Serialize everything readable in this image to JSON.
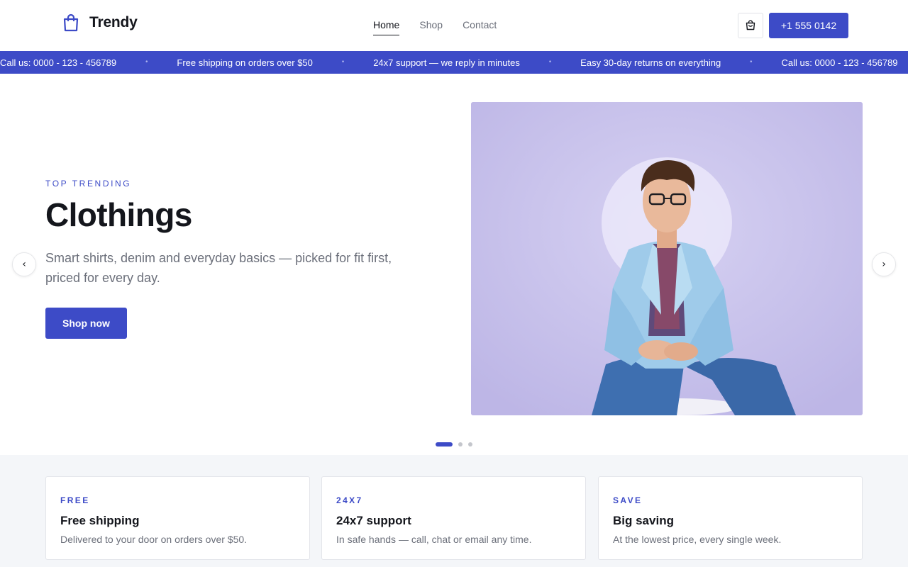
{
  "brand": {
    "name": "Trendy",
    "icon": "shopping-bag-icon",
    "accent": "#3d4bc7"
  },
  "nav": {
    "items": [
      "Home",
      "Shop",
      "Contact"
    ],
    "active": "Home"
  },
  "header": {
    "cart_icon": "cart-icon",
    "phone_label": "+1 555 0142"
  },
  "ticker": {
    "items": [
      "Call us: 0000 - 123 - 456789",
      "Free shipping on orders over $50",
      "24x7 support — we reply in minutes",
      "Easy 30-day returns on everything",
      "Call us: 0000 - 123 - 456789"
    ],
    "separator": "•"
  },
  "hero": {
    "eyebrow": "TOP TRENDING",
    "title": "Clothings",
    "description": "Smart shirts, denim and everyday basics — picked for fit first, priced for every day.",
    "cta": "Shop now",
    "prev_arrow": "‹",
    "next_arrow": "›",
    "slide_count": 3,
    "active_slide": 1
  },
  "features": [
    {
      "tag": "FREE",
      "title": "Free shipping",
      "desc": "Delivered to your door on orders over $50."
    },
    {
      "tag": "24X7",
      "title": "24x7 support",
      "desc": "In safe hands — call, chat or email any time."
    },
    {
      "tag": "SAVE",
      "title": "Big saving",
      "desc": "At the lowest price, every single week."
    }
  ]
}
